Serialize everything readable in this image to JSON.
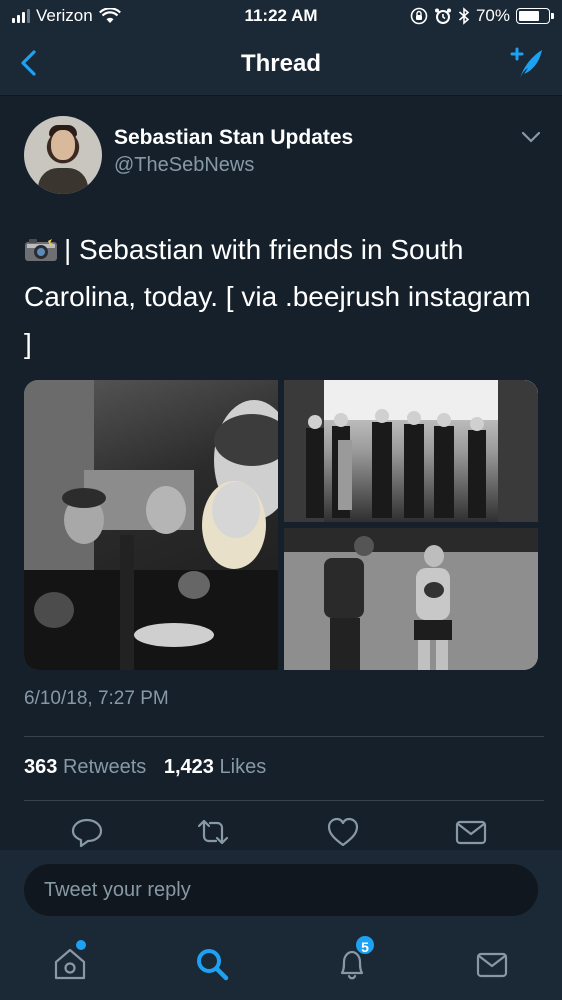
{
  "status_bar": {
    "carrier": "Verizon",
    "time": "11:22 AM",
    "battery": "70%",
    "battery_level": 0.7
  },
  "nav": {
    "title": "Thread"
  },
  "tweet": {
    "display_name": "Sebastian Stan Updates",
    "handle": "@TheSebNews",
    "text": "| Sebastian with friends in South Carolina, today. [ via .beejrush instagram ]",
    "timestamp": "6/10/18, 7:27 PM",
    "retweets_count": "363",
    "retweets_label": "Retweets",
    "likes_count": "1,423",
    "likes_label": "Likes"
  },
  "reply": {
    "placeholder": "Tweet your reply"
  },
  "tab_bar": {
    "notifications_badge": "5"
  },
  "colors": {
    "background": "#15202b",
    "bar": "#1b2836",
    "accent": "#1da1f2",
    "secondary_text": "#8899a6"
  }
}
